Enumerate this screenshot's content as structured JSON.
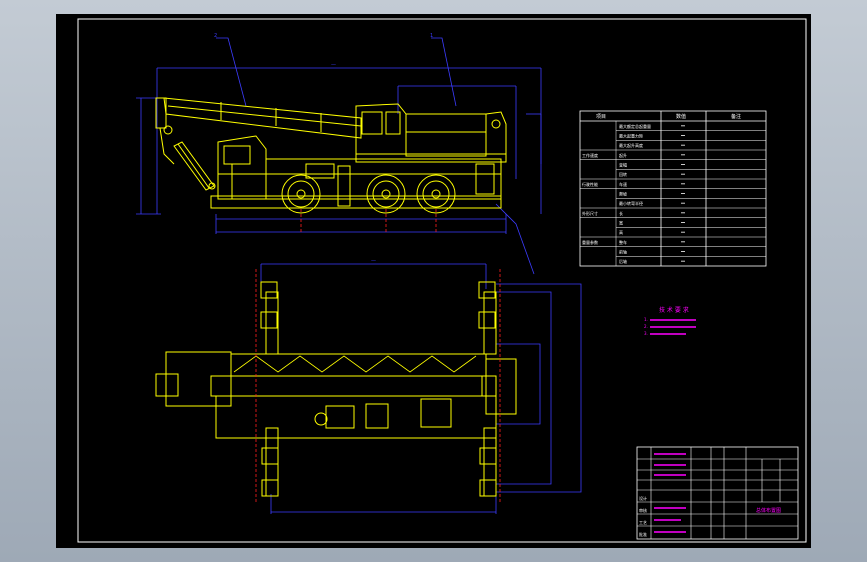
{
  "drawing": {
    "part_numbers": [
      "2",
      "1"
    ],
    "note_title": "技 术 要 求",
    "notes": [
      "1. ",
      "2. ",
      "3. "
    ],
    "spec_table": {
      "header": [
        "项目",
        "数值",
        "备注"
      ],
      "rows": [
        {
          "group": "",
          "item": "最大额定总起重量"
        },
        {
          "group": "",
          "item": "最大起重力矩"
        },
        {
          "group": "",
          "item": "最大起升高度"
        },
        {
          "group": "工作速度",
          "item": "起升"
        },
        {
          "group": "",
          "item": "变幅"
        },
        {
          "group": "",
          "item": "回转"
        },
        {
          "group": "行驶性能",
          "item": "车速"
        },
        {
          "group": "",
          "item": "爬坡"
        },
        {
          "group": "",
          "item": "最小转弯半径"
        },
        {
          "group": "外形尺寸",
          "item": "长"
        },
        {
          "group": "",
          "item": "宽"
        },
        {
          "group": "",
          "item": "高"
        },
        {
          "group": "重量参数",
          "item": "整车"
        },
        {
          "group": "",
          "item": "前轴"
        },
        {
          "group": "",
          "item": "后轴"
        }
      ]
    },
    "title_block": {
      "drawing_name": "总体布置图",
      "labels": [
        "设计",
        "审核",
        "工艺",
        "批准"
      ]
    }
  },
  "colors": {
    "background": "#000000",
    "frame": "#ffffff",
    "crane": "#ffff00",
    "dimension": "#3c3cff",
    "centerline": "#ff2020",
    "annotation": "#ff00ff"
  }
}
